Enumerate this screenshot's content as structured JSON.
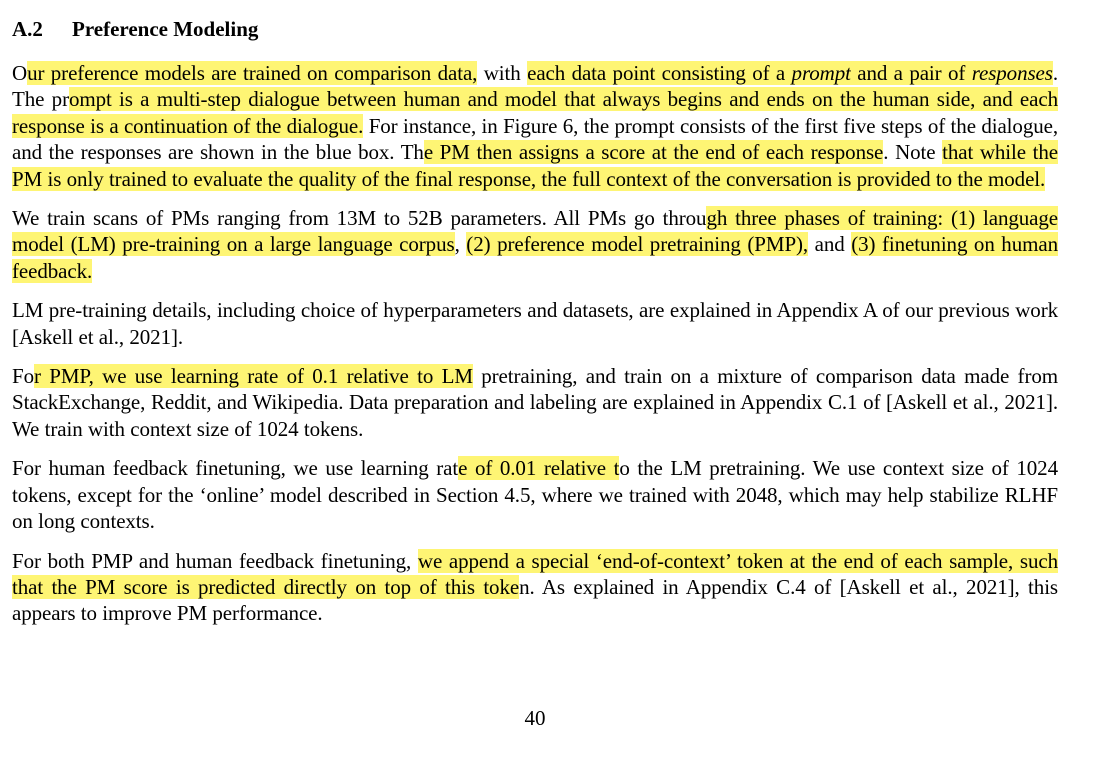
{
  "section": {
    "number": "A.2",
    "title": "Preference Modeling"
  },
  "highlight_color": "#fef574",
  "paragraphs": [
    {
      "runs": [
        {
          "text": "O",
          "hl": false
        },
        {
          "text": "ur preference models are trained on comparison data,",
          "hl": true
        },
        {
          "text": " with ",
          "hl": false
        },
        {
          "text": "each data point consisting of a ",
          "hl": true
        },
        {
          "text": "prompt",
          "hl": true,
          "em": true
        },
        {
          "text": " and a pair of ",
          "hl": true
        },
        {
          "text": "responses",
          "hl": true,
          "em": true
        },
        {
          "text": ". The pr",
          "hl": false
        },
        {
          "text": "ompt is a multi-step dialogue between human and model that always begins and ends on the human side, and each response is a continuation of the dialogue.",
          "hl": true
        },
        {
          "text": " For instance, in Figure 6, the prompt consists of the first five steps of the dialogue, and the responses are shown in the blue box. Th",
          "hl": false
        },
        {
          "text": "e PM then assigns a score at the end of each response",
          "hl": true
        },
        {
          "text": ". Note ",
          "hl": false
        },
        {
          "text": "that while the PM is only trained to evaluate the quality of the final response, the full context of the conversation is provided to the model.",
          "hl": true
        }
      ]
    },
    {
      "runs": [
        {
          "text": "We train scans of PMs ranging from 13M to 52B parameters. All PMs go throu",
          "hl": false
        },
        {
          "text": "gh three phases of training: (1) language model (LM) pre-training on a large language corpus",
          "hl": true
        },
        {
          "text": ", ",
          "hl": false
        },
        {
          "text": "(2) preference model pretraining (PMP),",
          "hl": true
        },
        {
          "text": " and ",
          "hl": false
        },
        {
          "text": "(3) finetuning on human feedback.",
          "hl": true
        }
      ]
    },
    {
      "runs": [
        {
          "text": "LM pre-training details, including choice of hyperparameters and datasets, are explained in Appendix A of our previous work [Askell et al., 2021].",
          "hl": false
        }
      ]
    },
    {
      "runs": [
        {
          "text": "Fo",
          "hl": false
        },
        {
          "text": "r PMP, we use learning rate of 0.1 relative to LM",
          "hl": true
        },
        {
          "text": " pretraining, and train on a mixture of comparison data made from StackExchange, Reddit, and Wikipedia. Data preparation and labeling are explained in Appendix C.1 of [Askell et al., 2021]. We train with context size of 1024 tokens.",
          "hl": false
        }
      ]
    },
    {
      "runs": [
        {
          "text": "For human feedback finetuning, we use learning rat",
          "hl": false
        },
        {
          "text": "e of 0.01 relative t",
          "hl": true
        },
        {
          "text": "o the LM pretraining. We use context size of 1024 tokens, except for the ‘online’ model described in Section 4.5, where we trained with 2048, which may help stabilize RLHF on long contexts.",
          "hl": false
        }
      ]
    },
    {
      "runs": [
        {
          "text": "For both PMP and human feedback finetuning, ",
          "hl": false
        },
        {
          "text": "we append a special ‘end-of-context’ token at the end of each sample, such that the PM score is predicted directly on top of this toke",
          "hl": true
        },
        {
          "text": "n. As explained in Appendix C.4 of [Askell et al., 2021], this appears to improve PM performance.",
          "hl": false
        }
      ]
    }
  ],
  "page_number": "40"
}
